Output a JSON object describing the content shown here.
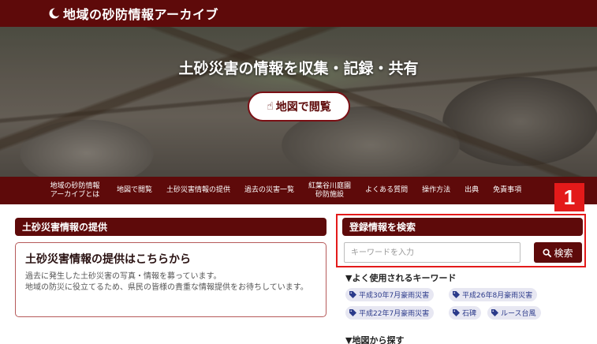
{
  "header": {
    "site_title": "地域の砂防情報アーカイブ",
    "logo_icon": "crescent-logo-icon"
  },
  "hero": {
    "headline": "土砂災害の情報を収集・記録・共有",
    "map_button_label": "地図で閲覧",
    "map_button_icon": "pointing-hand-icon"
  },
  "nav": {
    "items": [
      {
        "line1": "地域の砂防情報",
        "line2": "アーカイブとは"
      },
      {
        "line1": "地図で閲覧"
      },
      {
        "line1": "土砂災害情報の提供"
      },
      {
        "line1": "過去の災害一覧"
      },
      {
        "line1": "紅葉谷川庭園",
        "line2": "砂防施設"
      },
      {
        "line1": "よくある質問"
      },
      {
        "line1": "操作方法"
      },
      {
        "line1": "出典"
      },
      {
        "line1": "免責事項"
      }
    ]
  },
  "marker": {
    "label": "1"
  },
  "left": {
    "heading": "土砂災害情報の提供",
    "card_title": "土砂災害情報の提供はこちらから",
    "card_text_1": "過去に発生した土砂災害の写真・情報を募っています。",
    "card_text_2": "地域の防災に役立てるため、県民の皆様の貴重な情報提供をお待ちしています。"
  },
  "search": {
    "heading": "登録情報を検索",
    "input_value": "",
    "input_placeholder": "キーワードを入力",
    "button_label": "検索",
    "button_icon": "search-icon"
  },
  "keywords": {
    "heading": "▼よく使用されるキーワード",
    "tags": [
      "平成30年7月豪雨災害",
      "平成26年8月豪雨災害",
      "平成22年7月豪雨災害",
      "石碑",
      "ルース台風"
    ]
  },
  "map_section": {
    "heading": "▼地図から探す"
  },
  "colors": {
    "brand": "#5e0a0a",
    "marker": "#e31a1a",
    "tag_bg": "#e7e7f2",
    "tag_text": "#2b3a8a"
  }
}
